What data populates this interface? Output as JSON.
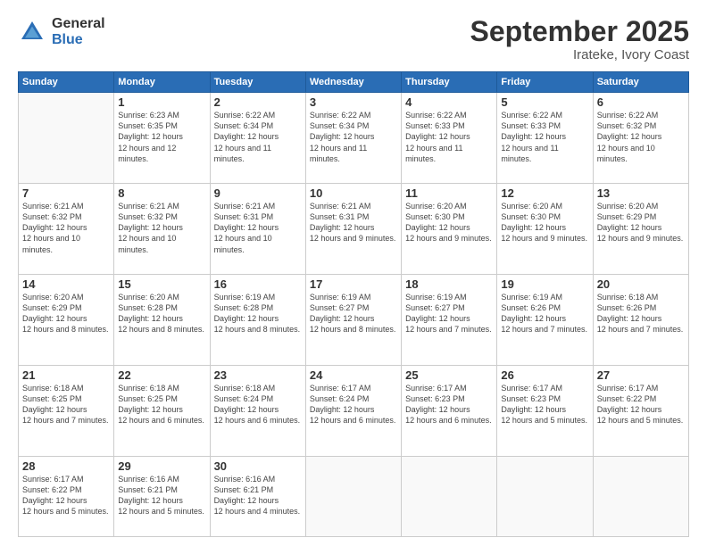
{
  "logo": {
    "general": "General",
    "blue": "Blue"
  },
  "header": {
    "title": "September 2025",
    "subtitle": "Irateke, Ivory Coast"
  },
  "weekdays": [
    "Sunday",
    "Monday",
    "Tuesday",
    "Wednesday",
    "Thursday",
    "Friday",
    "Saturday"
  ],
  "weeks": [
    [
      {
        "day": "",
        "empty": true
      },
      {
        "day": "1",
        "sunrise": "6:23 AM",
        "sunset": "6:35 PM",
        "daylight": "12 hours and 12 minutes."
      },
      {
        "day": "2",
        "sunrise": "6:22 AM",
        "sunset": "6:34 PM",
        "daylight": "12 hours and 11 minutes."
      },
      {
        "day": "3",
        "sunrise": "6:22 AM",
        "sunset": "6:34 PM",
        "daylight": "12 hours and 11 minutes."
      },
      {
        "day": "4",
        "sunrise": "6:22 AM",
        "sunset": "6:33 PM",
        "daylight": "12 hours and 11 minutes."
      },
      {
        "day": "5",
        "sunrise": "6:22 AM",
        "sunset": "6:33 PM",
        "daylight": "12 hours and 11 minutes."
      },
      {
        "day": "6",
        "sunrise": "6:22 AM",
        "sunset": "6:32 PM",
        "daylight": "12 hours and 10 minutes."
      }
    ],
    [
      {
        "day": "7",
        "sunrise": "6:21 AM",
        "sunset": "6:32 PM",
        "daylight": "12 hours and 10 minutes."
      },
      {
        "day": "8",
        "sunrise": "6:21 AM",
        "sunset": "6:32 PM",
        "daylight": "12 hours and 10 minutes."
      },
      {
        "day": "9",
        "sunrise": "6:21 AM",
        "sunset": "6:31 PM",
        "daylight": "12 hours and 10 minutes."
      },
      {
        "day": "10",
        "sunrise": "6:21 AM",
        "sunset": "6:31 PM",
        "daylight": "12 hours and 9 minutes."
      },
      {
        "day": "11",
        "sunrise": "6:20 AM",
        "sunset": "6:30 PM",
        "daylight": "12 hours and 9 minutes."
      },
      {
        "day": "12",
        "sunrise": "6:20 AM",
        "sunset": "6:30 PM",
        "daylight": "12 hours and 9 minutes."
      },
      {
        "day": "13",
        "sunrise": "6:20 AM",
        "sunset": "6:29 PM",
        "daylight": "12 hours and 9 minutes."
      }
    ],
    [
      {
        "day": "14",
        "sunrise": "6:20 AM",
        "sunset": "6:29 PM",
        "daylight": "12 hours and 8 minutes."
      },
      {
        "day": "15",
        "sunrise": "6:20 AM",
        "sunset": "6:28 PM",
        "daylight": "12 hours and 8 minutes."
      },
      {
        "day": "16",
        "sunrise": "6:19 AM",
        "sunset": "6:28 PM",
        "daylight": "12 hours and 8 minutes."
      },
      {
        "day": "17",
        "sunrise": "6:19 AM",
        "sunset": "6:27 PM",
        "daylight": "12 hours and 8 minutes."
      },
      {
        "day": "18",
        "sunrise": "6:19 AM",
        "sunset": "6:27 PM",
        "daylight": "12 hours and 7 minutes."
      },
      {
        "day": "19",
        "sunrise": "6:19 AM",
        "sunset": "6:26 PM",
        "daylight": "12 hours and 7 minutes."
      },
      {
        "day": "20",
        "sunrise": "6:18 AM",
        "sunset": "6:26 PM",
        "daylight": "12 hours and 7 minutes."
      }
    ],
    [
      {
        "day": "21",
        "sunrise": "6:18 AM",
        "sunset": "6:25 PM",
        "daylight": "12 hours and 7 minutes."
      },
      {
        "day": "22",
        "sunrise": "6:18 AM",
        "sunset": "6:25 PM",
        "daylight": "12 hours and 6 minutes."
      },
      {
        "day": "23",
        "sunrise": "6:18 AM",
        "sunset": "6:24 PM",
        "daylight": "12 hours and 6 minutes."
      },
      {
        "day": "24",
        "sunrise": "6:17 AM",
        "sunset": "6:24 PM",
        "daylight": "12 hours and 6 minutes."
      },
      {
        "day": "25",
        "sunrise": "6:17 AM",
        "sunset": "6:23 PM",
        "daylight": "12 hours and 6 minutes."
      },
      {
        "day": "26",
        "sunrise": "6:17 AM",
        "sunset": "6:23 PM",
        "daylight": "12 hours and 5 minutes."
      },
      {
        "day": "27",
        "sunrise": "6:17 AM",
        "sunset": "6:22 PM",
        "daylight": "12 hours and 5 minutes."
      }
    ],
    [
      {
        "day": "28",
        "sunrise": "6:17 AM",
        "sunset": "6:22 PM",
        "daylight": "12 hours and 5 minutes."
      },
      {
        "day": "29",
        "sunrise": "6:16 AM",
        "sunset": "6:21 PM",
        "daylight": "12 hours and 5 minutes."
      },
      {
        "day": "30",
        "sunrise": "6:16 AM",
        "sunset": "6:21 PM",
        "daylight": "12 hours and 4 minutes."
      },
      {
        "day": "",
        "empty": true
      },
      {
        "day": "",
        "empty": true
      },
      {
        "day": "",
        "empty": true
      },
      {
        "day": "",
        "empty": true
      }
    ]
  ]
}
